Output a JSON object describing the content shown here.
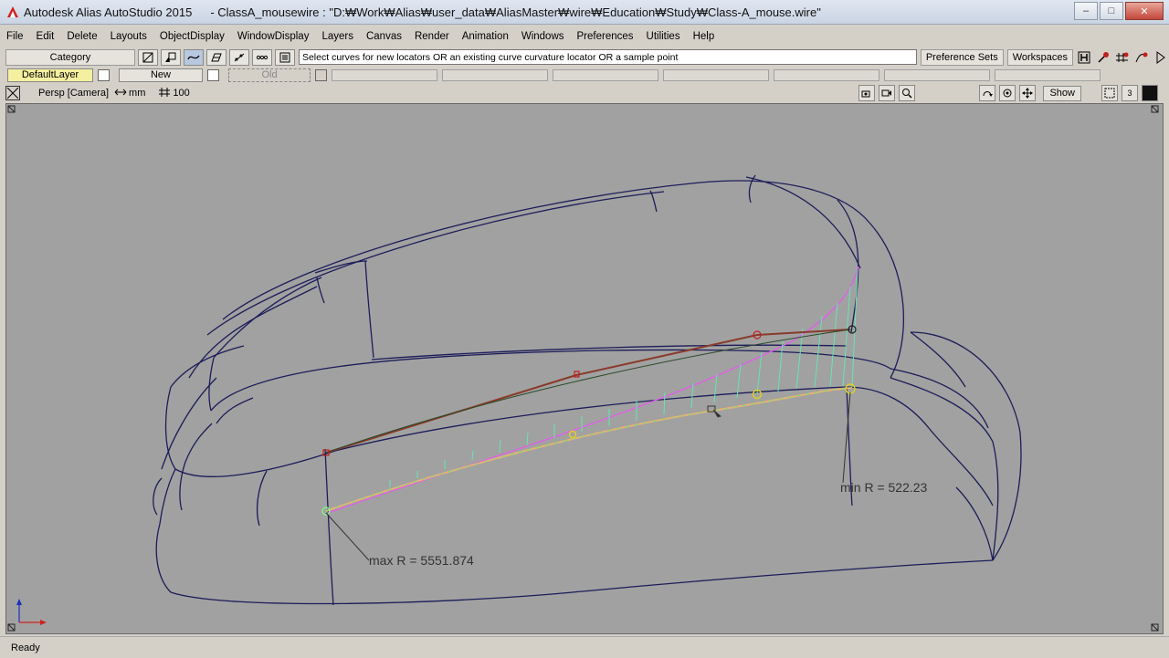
{
  "window": {
    "app_title": "Autodesk Alias AutoStudio 2015",
    "doc_title": "- ClassA_mousewire : \"D:₩Work₩Alias₩user_data₩AliasMaster₩wire₩Education₩Study₩Class-A_mouse.wire\"",
    "minimize": "–",
    "maximize": "□",
    "close": "✕"
  },
  "menu": [
    "File",
    "Edit",
    "Delete",
    "Layouts",
    "ObjectDisplay",
    "WindowDisplay",
    "Layers",
    "Canvas",
    "Render",
    "Animation",
    "Windows",
    "Preferences",
    "Utilities",
    "Help"
  ],
  "toolbar": {
    "category_label": "Category",
    "prompt": "Select curves for new locators OR an existing curve curvature locator OR a sample point",
    "preference_sets": "Preference Sets",
    "workspaces": "Workspaces"
  },
  "layers": {
    "default": "DefaultLayer",
    "new": "New",
    "old": "Old"
  },
  "viewport": {
    "camera": "Persp [Camera]",
    "unit": "mm",
    "zoom": "100",
    "show_button": "Show",
    "quad_count": "3",
    "min_label": "min R = 522.23",
    "max_label": "max R = 5551.874"
  },
  "status": {
    "text": "Ready"
  },
  "colors": {
    "viewport_bg": "#a1a1a1",
    "wire": "#1c1c5a",
    "locator_curve": "#8a3a2a",
    "comb": "#64e6b0",
    "envelope": "#e060e8"
  }
}
